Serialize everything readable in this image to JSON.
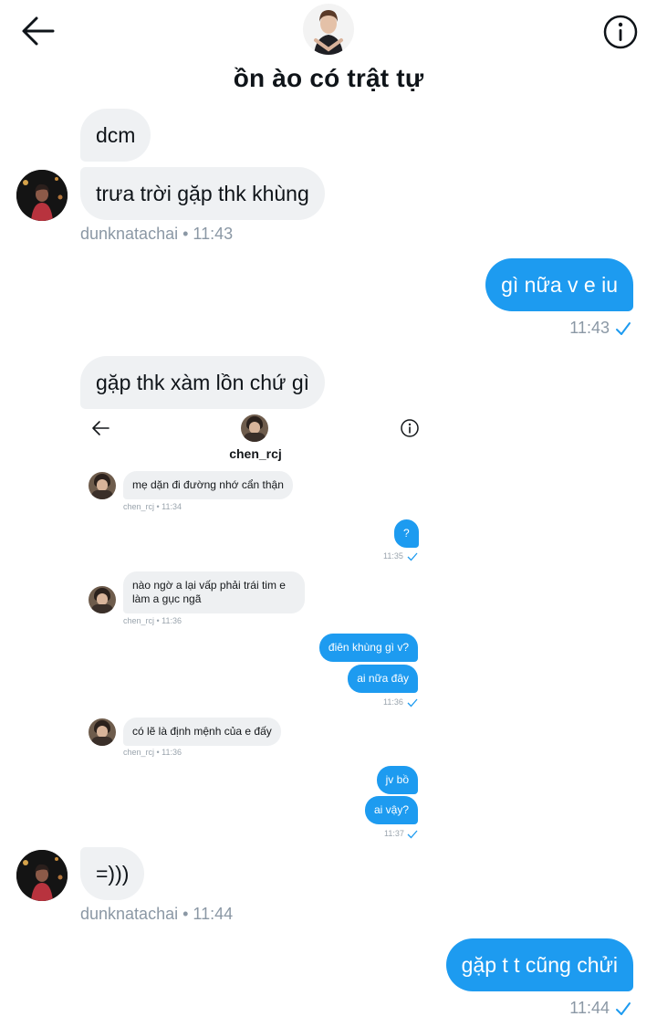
{
  "header": {
    "title": "ồn ào có trật tự",
    "back_icon": "arrow-left-icon",
    "info_icon": "info-circle-icon"
  },
  "messages": [
    {
      "side": "in",
      "text": "dcm"
    },
    {
      "side": "in",
      "text": "trưa trời gặp thk khùng"
    },
    {
      "side": "meta",
      "text": "dunknatachai • 11:43"
    },
    {
      "side": "out",
      "text": "gì nữa v e iu"
    },
    {
      "side": "meta",
      "text": "11:43"
    },
    {
      "side": "in",
      "text": "gặp thk xàm lồn chứ gì"
    },
    {
      "side": "in",
      "text": "=)))"
    },
    {
      "side": "meta",
      "text": "dunknatachai • 11:44"
    },
    {
      "side": "out",
      "text": "gặp t t cũng chửi"
    },
    {
      "side": "meta",
      "text": "11:44"
    }
  ],
  "screenshot": {
    "title": "chen_rcj",
    "messages": [
      {
        "side": "in",
        "text": "mẹ dặn đi đường nhớ cẩn thận"
      },
      {
        "side": "meta",
        "text": "chen_rcj • 11:34"
      },
      {
        "side": "out",
        "text": "?"
      },
      {
        "side": "meta",
        "text": "11:35"
      },
      {
        "side": "in",
        "text": "nào ngờ a lại vấp phải trái tim e"
      },
      {
        "side": "in",
        "text": "làm a gục ngã"
      },
      {
        "side": "meta",
        "text": "chen_rcj • 11:36"
      },
      {
        "side": "out",
        "text": "điên khùng gì v?"
      },
      {
        "side": "out",
        "text": "ai nữa đây"
      },
      {
        "side": "meta",
        "text": "11:36"
      },
      {
        "side": "in",
        "text": "có lẽ là định mệnh của e đấy"
      },
      {
        "side": "meta",
        "text": "chen_rcj • 11:36"
      },
      {
        "side": "out",
        "text": "jv bồ"
      },
      {
        "side": "out",
        "text": "ai vậy?"
      },
      {
        "side": "meta",
        "text": "11:37"
      }
    ]
  },
  "colors": {
    "accent": "#1d9bf0",
    "incoming_bubble": "#eff1f3",
    "meta_text": "#8b98a5"
  }
}
